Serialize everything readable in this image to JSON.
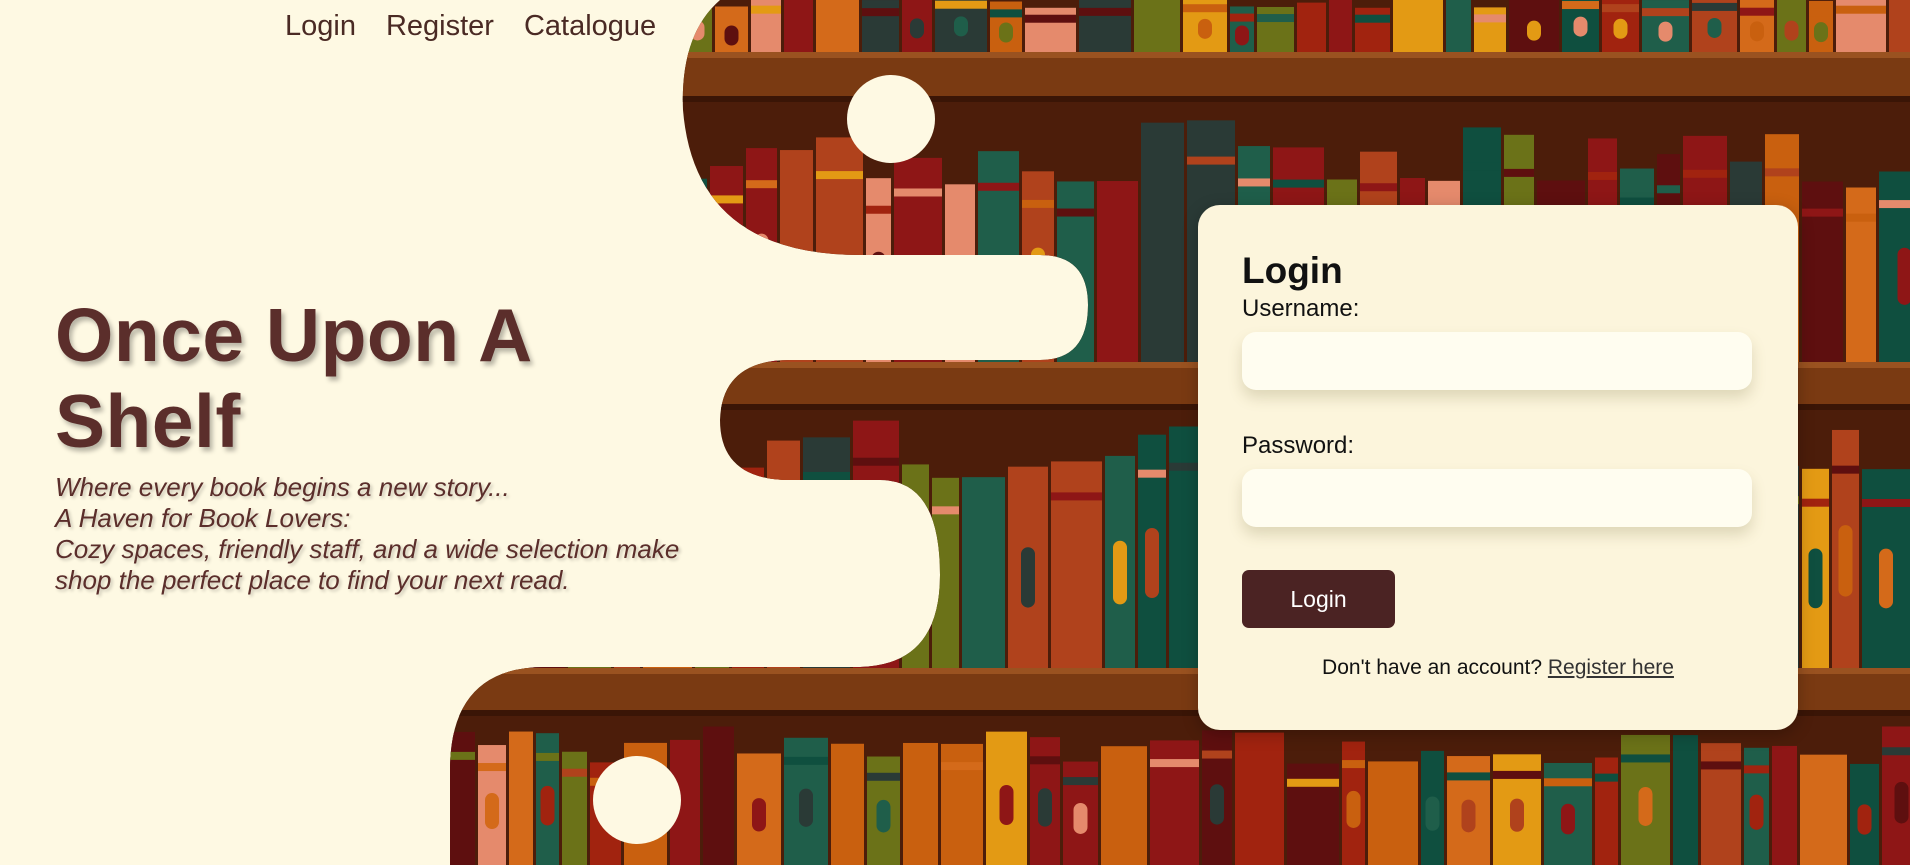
{
  "nav": {
    "links": [
      "Login",
      "Register",
      "Catalogue"
    ]
  },
  "hero": {
    "title": "Once Upon A Shelf",
    "tagline_1": "Where every book begins a new story...",
    "tagline_2": "A Haven for Book Lovers:",
    "tagline_3": "Cozy spaces, friendly staff, and a wide selection make",
    "tagline_4": "shop the perfect place to find your next read."
  },
  "login_form": {
    "heading": "Login",
    "username_label": "Username:",
    "username_value": "",
    "password_label": "Password:",
    "password_value": "",
    "submit_label": "Login",
    "register_prompt": "Don't have an account?",
    "register_link": "Register here"
  },
  "colors": {
    "background": "#fef9e3",
    "title": "#5b2e2b",
    "button": "#4b2323",
    "card": "#fcf5dc",
    "shelf_wood": "#7a3a12",
    "shelf_back": "#4c1d0a"
  }
}
